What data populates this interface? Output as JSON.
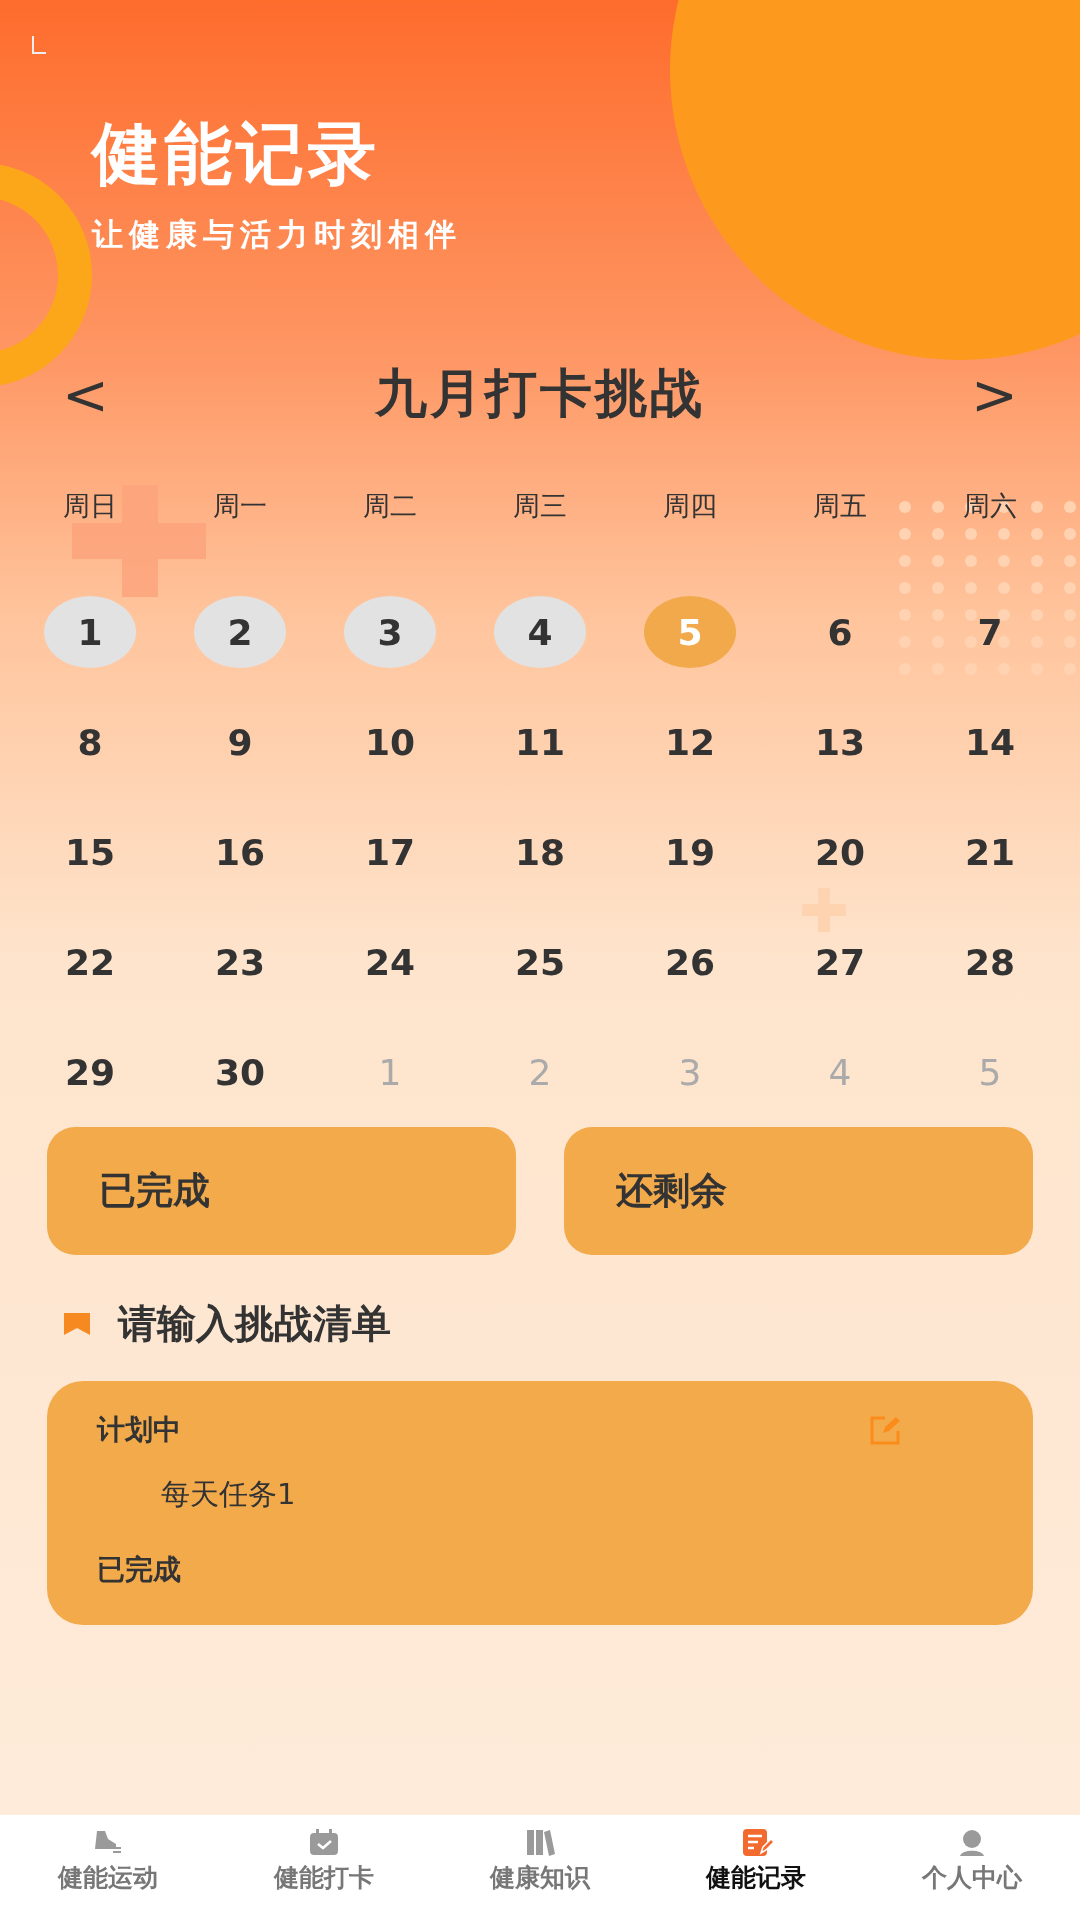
{
  "header": {
    "title": "健能记录",
    "subtitle": "让健康与活力时刻相伴"
  },
  "calendar": {
    "prev": "<",
    "title": "九月打卡挑战",
    "next": ">",
    "weekdays": [
      "周日",
      "周一",
      "周二",
      "周三",
      "周四",
      "周五",
      "周六"
    ],
    "days": [
      {
        "label": "1",
        "kind": "past"
      },
      {
        "label": "2",
        "kind": "past"
      },
      {
        "label": "3",
        "kind": "past"
      },
      {
        "label": "4",
        "kind": "past"
      },
      {
        "label": "5",
        "kind": "today"
      },
      {
        "label": "6",
        "kind": "normal"
      },
      {
        "label": "7",
        "kind": "normal"
      },
      {
        "label": "8",
        "kind": "normal"
      },
      {
        "label": "9",
        "kind": "normal"
      },
      {
        "label": "10",
        "kind": "normal"
      },
      {
        "label": "11",
        "kind": "normal"
      },
      {
        "label": "12",
        "kind": "normal"
      },
      {
        "label": "13",
        "kind": "normal"
      },
      {
        "label": "14",
        "kind": "normal"
      },
      {
        "label": "15",
        "kind": "normal"
      },
      {
        "label": "16",
        "kind": "normal"
      },
      {
        "label": "17",
        "kind": "normal"
      },
      {
        "label": "18",
        "kind": "normal"
      },
      {
        "label": "19",
        "kind": "normal"
      },
      {
        "label": "20",
        "kind": "normal"
      },
      {
        "label": "21",
        "kind": "normal"
      },
      {
        "label": "22",
        "kind": "normal"
      },
      {
        "label": "23",
        "kind": "normal"
      },
      {
        "label": "24",
        "kind": "normal"
      },
      {
        "label": "25",
        "kind": "normal"
      },
      {
        "label": "26",
        "kind": "normal"
      },
      {
        "label": "27",
        "kind": "normal"
      },
      {
        "label": "28",
        "kind": "normal"
      },
      {
        "label": "29",
        "kind": "normal"
      },
      {
        "label": "30",
        "kind": "normal"
      },
      {
        "label": "1",
        "kind": "other"
      },
      {
        "label": "2",
        "kind": "other"
      },
      {
        "label": "3",
        "kind": "other"
      },
      {
        "label": "4",
        "kind": "other"
      },
      {
        "label": "5",
        "kind": "other"
      }
    ]
  },
  "summary": [
    "已完成",
    "还剩余"
  ],
  "checklist": {
    "title": "请输入挑战清单",
    "planned_label": "计划中",
    "tasks": [
      "每天任务1"
    ],
    "done_label": "已完成"
  },
  "tabs": [
    {
      "label": "健能运动",
      "selected": false
    },
    {
      "label": "健能打卡",
      "selected": false
    },
    {
      "label": "健康知识",
      "selected": false
    },
    {
      "label": "健能记录",
      "selected": true
    },
    {
      "label": "个人中心",
      "selected": false
    }
  ]
}
